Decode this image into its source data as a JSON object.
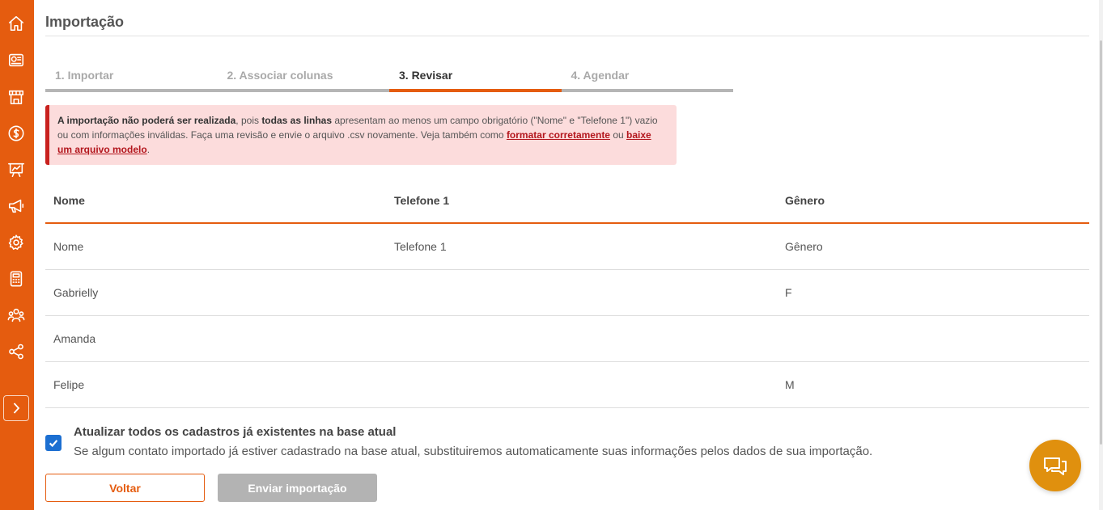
{
  "sidebar": {
    "icons": [
      "home-icon",
      "dashboard-icon",
      "store-icon",
      "dollar-icon",
      "chart-board-icon",
      "megaphone-icon",
      "gear-icon",
      "calculator-icon",
      "users-icon",
      "share-icon"
    ],
    "expand_icon": "chevron-right-icon",
    "color": "#e55c0f"
  },
  "page": {
    "title": "Importação"
  },
  "steps": [
    {
      "label": "1. Importar",
      "state": "inactive"
    },
    {
      "label": "2. Associar colunas",
      "state": "inactive"
    },
    {
      "label": "3. Revisar",
      "state": "active"
    },
    {
      "label": "4. Agendar",
      "state": "inactive"
    }
  ],
  "alert": {
    "bold1": "A importação não poderá ser realizada",
    "text1": ", pois ",
    "bold2": "todas as linhas",
    "text2": " apresentam ao menos um campo obrigatório (\"Nome\" e \"Telefone 1\") vazio ou com informações inválidas. Faça uma revisão e envie o arquivo .csv novamente. Veja também como ",
    "link1": "formatar corretamente",
    "text3": " ou ",
    "link2": "baixe um arquivo modelo",
    "text4": "."
  },
  "table": {
    "headers": [
      "Nome",
      "Telefone 1",
      "Gênero"
    ],
    "rows": [
      [
        "Nome",
        "Telefone 1",
        "Gênero"
      ],
      [
        "Gabrielly",
        "",
        "F"
      ],
      [
        "Amanda",
        "",
        ""
      ],
      [
        "Felipe",
        "",
        "M"
      ]
    ]
  },
  "update_option": {
    "checked": true,
    "title": "Atualizar todos os cadastros já existentes na base atual",
    "description": "Se algum contato importado já estiver cadastrado na base atual, substituiremos automaticamente suas informações pelos dados de sua importação."
  },
  "buttons": {
    "back": "Voltar",
    "send": "Enviar importação"
  },
  "chat": {
    "icon": "chat-bubbles-icon"
  },
  "colors": {
    "accent": "#e55c0f",
    "error": "#c9211e",
    "error_bg": "#fcdcdc",
    "checkbox": "#1c6fd1",
    "chat": "#e0900e"
  }
}
